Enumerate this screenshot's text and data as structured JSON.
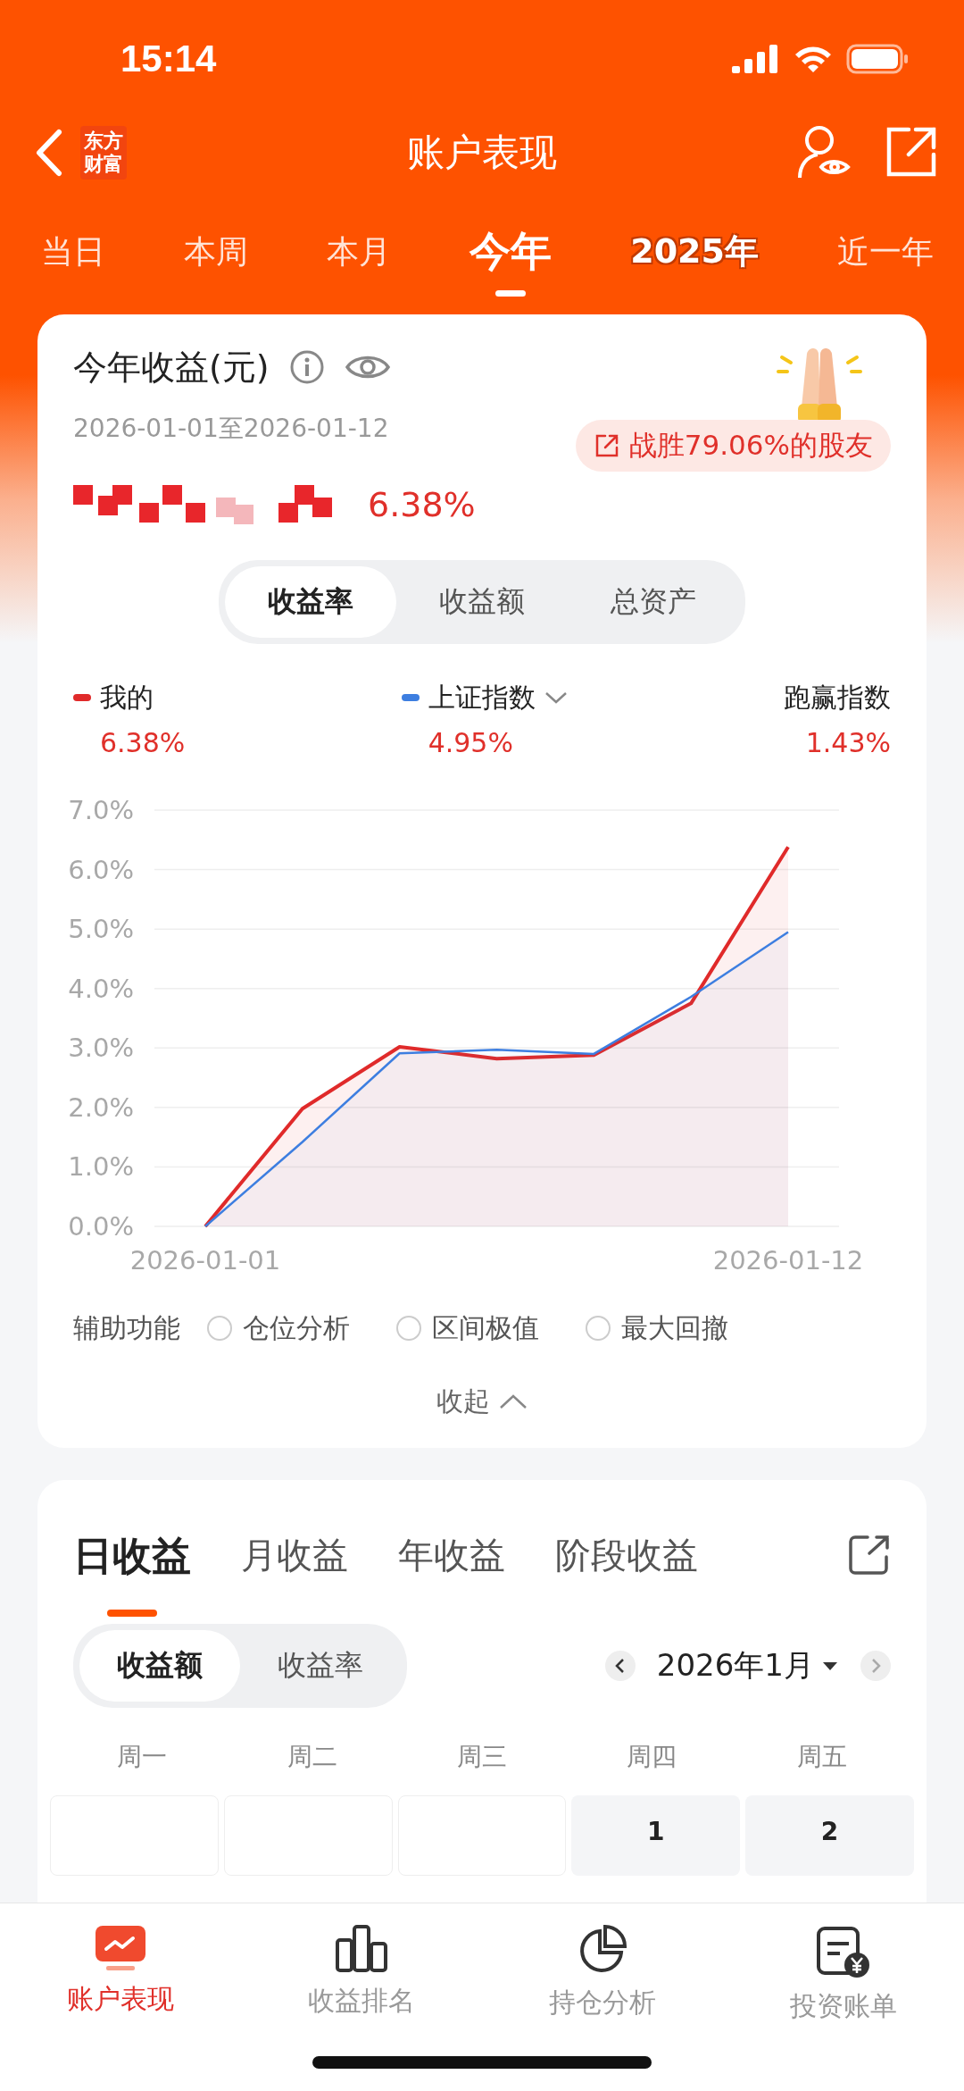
{
  "status_bar": {
    "time": "15:14"
  },
  "nav": {
    "logo": [
      "东方",
      "财富"
    ],
    "title": "账户表现"
  },
  "period_tabs": [
    {
      "label": "当日",
      "selected": false,
      "kind": "plain"
    },
    {
      "label": "本周",
      "selected": false,
      "kind": "plain"
    },
    {
      "label": "本月",
      "selected": false,
      "kind": "plain"
    },
    {
      "label": "今年",
      "selected": true,
      "kind": "plain"
    },
    {
      "label": "2025年",
      "selected": false,
      "kind": "outlined"
    },
    {
      "label": "近一年",
      "selected": false,
      "kind": "plain"
    }
  ],
  "summary": {
    "title": "今年收益(元)",
    "date_range": "2026-01-01至2026-01-12",
    "badge": "战胜79.06%的股友",
    "return": "6.38%",
    "metric_tabs": [
      {
        "label": "收益率",
        "selected": true
      },
      {
        "label": "收益额",
        "selected": false
      },
      {
        "label": "总资产",
        "selected": false
      }
    ],
    "legend": [
      {
        "kind": "series",
        "value": "6.38%",
        "dropdown": false
      },
      {
        "kind": "series",
        "value": "4.95%",
        "dropdown": true
      },
      {
        "kind": "diff",
        "label": "跑赢指数",
        "value": "1.43%",
        "dropdown": false
      }
    ],
    "chart_data": {
      "type": "area",
      "grid": true,
      "categories": [
        "2026-01-01",
        null,
        null,
        null,
        null,
        null,
        "2026-01-12"
      ],
      "series": [
        {
          "name": "我的",
          "color": "#e02a2a",
          "values": [
            0,
            1.98,
            3.02,
            2.82,
            2.88,
            3.75,
            6.38
          ]
        },
        {
          "name": "上证指数",
          "color": "#3d7ee0",
          "values": [
            0,
            1.42,
            2.91,
            2.97,
            2.9,
            3.86,
            4.95
          ]
        }
      ],
      "ylim": [
        0,
        7
      ],
      "yticks": [
        {
          "value": 0,
          "label": "0.0%"
        },
        {
          "value": 1,
          "label": "1.0%"
        },
        {
          "value": 2,
          "label": "2.0%"
        },
        {
          "value": 3,
          "label": "3.0%"
        },
        {
          "value": 4,
          "label": "4.0%"
        },
        {
          "value": 5,
          "label": "5.0%"
        },
        {
          "value": 6,
          "label": "6.0%"
        },
        {
          "value": 7,
          "label": "7.0%"
        }
      ]
    },
    "aux_label": "辅助功能",
    "aux_options": [
      {
        "label": "仓位分析",
        "checked": false
      },
      {
        "label": "区间极值",
        "checked": false
      },
      {
        "label": "最大回撤",
        "checked": false
      }
    ],
    "collapse": "收起"
  },
  "earnings": {
    "tabs": [
      {
        "label": "日收益",
        "selected": true
      },
      {
        "label": "月收益",
        "selected": false
      },
      {
        "label": "年收益",
        "selected": false
      },
      {
        "label": "阶段收益",
        "selected": false
      }
    ],
    "mode_tabs": [
      {
        "label": "收益额",
        "selected": true
      },
      {
        "label": "收益率",
        "selected": false
      }
    ],
    "month": "2026年1月",
    "weekdays": [
      "周一",
      "周二",
      "周三",
      "周四",
      "周五"
    ],
    "cells": [
      {
        "kind": "blank"
      },
      {
        "kind": "blank"
      },
      {
        "kind": "blank"
      },
      {
        "kind": "day",
        "day": "1"
      },
      {
        "kind": "day",
        "day": "2"
      }
    ]
  },
  "bottom_nav": [
    {
      "label": "账户表现",
      "selected": true
    },
    {
      "label": "收益排名",
      "selected": false
    },
    {
      "label": "持仓分析",
      "selected": false
    },
    {
      "label": "投资账单",
      "selected": false
    }
  ]
}
